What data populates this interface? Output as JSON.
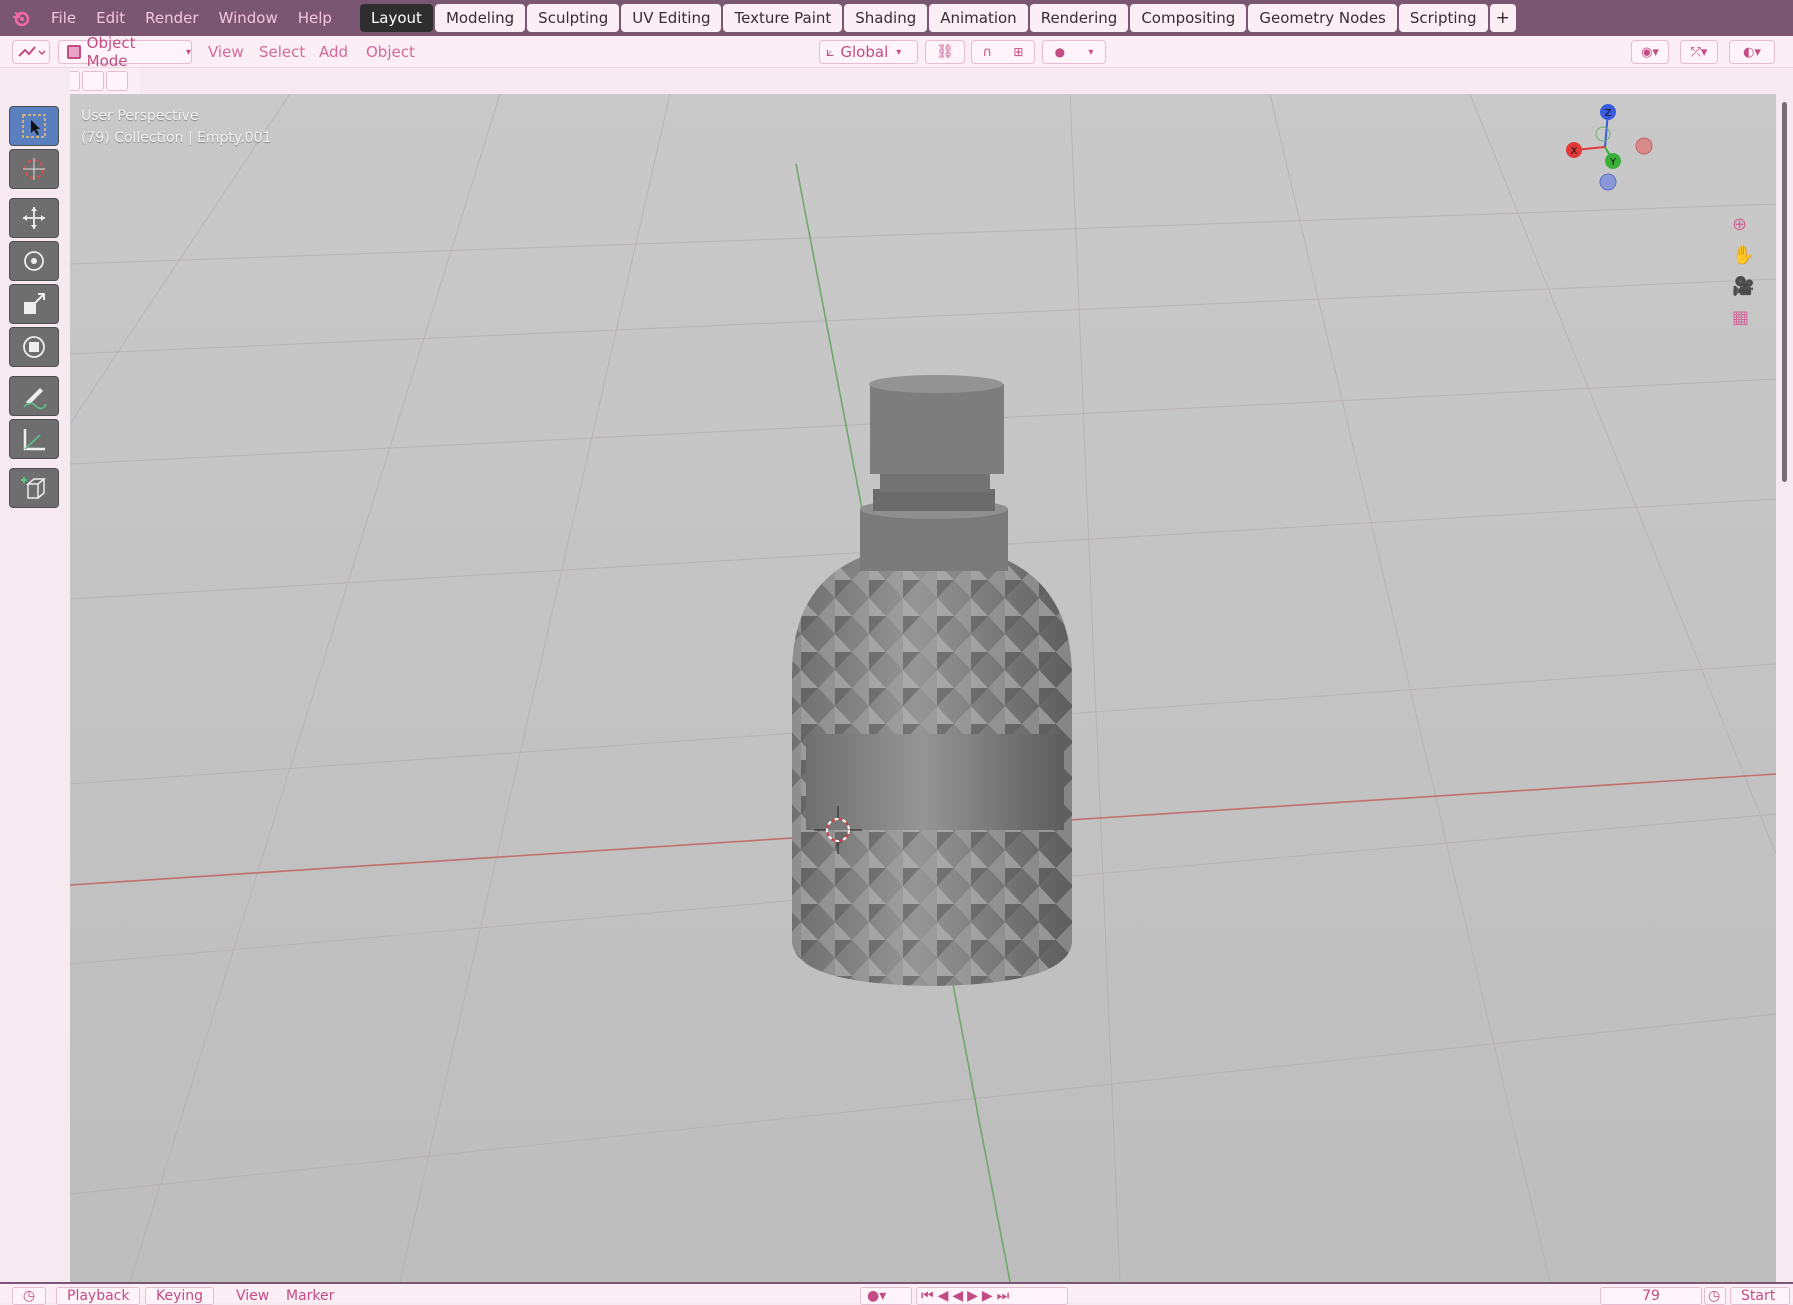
{
  "menu": {
    "file": "File",
    "edit": "Edit",
    "render": "Render",
    "window": "Window",
    "help": "Help"
  },
  "workspaces": [
    "Layout",
    "Modeling",
    "Sculpting",
    "UV Editing",
    "Texture Paint",
    "Shading",
    "Animation",
    "Rendering",
    "Compositing",
    "Geometry Nodes",
    "Scripting"
  ],
  "add_tab": "+",
  "header": {
    "mode": "Object Mode",
    "view": "View",
    "select": "Select",
    "add": "Add",
    "object": "Object",
    "transform_orientation": "Global"
  },
  "viewport": {
    "perspective": "User Perspective",
    "collection_info": "(79) Collection | Empty.001"
  },
  "gizmo": {
    "z": "Z",
    "x": "X",
    "y": "Y"
  },
  "timeline": {
    "playback": "Playback",
    "keying": "Keying",
    "view": "View",
    "marker": "Marker",
    "current_frame": "79",
    "start_label": "Start"
  },
  "colors": {
    "accent": "#c24c84",
    "topbar": "#7a5670",
    "axis_x": "#e03a3a",
    "axis_y": "#3ab03a",
    "axis_z": "#3a5ae0"
  }
}
